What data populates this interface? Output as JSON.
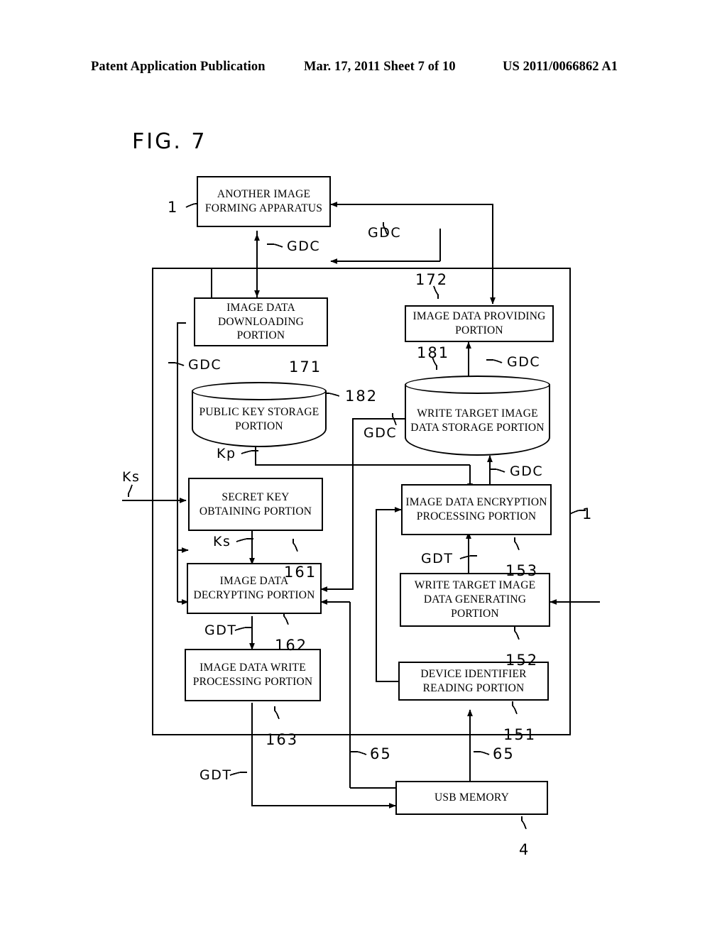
{
  "header": {
    "left": "Patent Application Publication",
    "middle": "Mar. 17, 2011  Sheet 7 of 10",
    "right": "US 2011/0066862 A1"
  },
  "figure": {
    "label": "FIG.  7"
  },
  "nodes": {
    "another_apparatus": "ANOTHER IMAGE FORMING APPARATUS",
    "downloading": "IMAGE DATA DOWNLOADING PORTION",
    "providing": "IMAGE DATA PROVIDING PORTION",
    "public_key_storage": "PUBLIC KEY STORAGE PORTION",
    "write_target_storage": "WRITE TARGET IMAGE DATA STORAGE PORTION",
    "secret_key": "SECRET KEY OBTAINING PORTION",
    "encryption": "IMAGE DATA ENCRYPTION PROCESSING PORTION",
    "decrypting": "IMAGE DATA DECRYPTING PORTION",
    "write_target_generating": "WRITE TARGET IMAGE DATA GENERATING PORTION",
    "write_processing": "IMAGE DATA WRITE PROCESSING PORTION",
    "device_identifier": "DEVICE IDENTIFIER READING PORTION",
    "usb_memory": "USB MEMORY"
  },
  "refs": {
    "apparatus_top": "1",
    "apparatus_right": "1",
    "downloading": "171",
    "providing": "172",
    "public_key_storage": "182",
    "write_target_storage": "181",
    "secret_key": "161",
    "encryption": "153",
    "decrypting": "162",
    "write_target_generating": "152",
    "write_processing": "163",
    "device_identifier": "151",
    "usb_memory": "4",
    "interface_left": "65",
    "interface_right": "65"
  },
  "signals": {
    "gdc_top_left": "GDC",
    "gdc_top_right": "GDC",
    "gdc_download": "GDC",
    "gdc_providing": "GDC",
    "gdc_middle": "GDC",
    "gdc_encryption": "GDC",
    "kp": "Kp",
    "ks_external": "Ks",
    "ks_internal": "Ks",
    "gdt_decrypt": "GDT",
    "gdt_encrypt": "GDT",
    "gdt_bottom": "GDT"
  },
  "colors": {
    "line": "#000000",
    "background": "#ffffff"
  }
}
